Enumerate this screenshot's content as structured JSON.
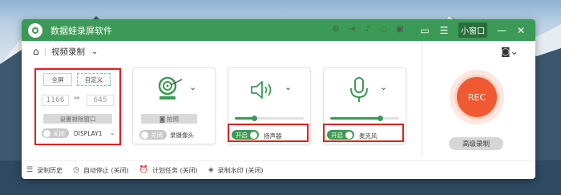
{
  "app": {
    "title": "数据蛙录屏软件"
  },
  "titlebar": {
    "mini_window_label": "小窗口",
    "icons": [
      "chat-icon",
      "menu-icon",
      "minimize-icon",
      "close-icon"
    ]
  },
  "toolbar": {
    "mode_label": "视频录制",
    "icons": [
      "gear-icon",
      "export-icon",
      "volume-icon",
      "mouse-icon",
      "fit-icon"
    ]
  },
  "screen_panel": {
    "fullscreen_label": "全屏",
    "custom_label": "自定义",
    "width_value": "1166",
    "height_value": "645",
    "exclude_window_label": "设置排除窗口",
    "toggle_state": "关闭",
    "display_label": "DISPLAY1"
  },
  "camera_panel": {
    "photo_label": "拍照",
    "toggle_state": "关闭",
    "label": "录摄像头"
  },
  "speaker_panel": {
    "toggle_state": "开启",
    "label": "扬声器",
    "volume_level": 0.28
  },
  "mic_panel": {
    "toggle_state": "开启",
    "label": "麦克风",
    "volume_level": 0.72
  },
  "record": {
    "rec_label": "REC",
    "advanced_label": "高级录制"
  },
  "statusbar": {
    "history": "录制历史",
    "auto_stop": "自动停止 (关闭)",
    "schedule": "计划任务 (关闭)",
    "watermark": "录制水印 (关闭)"
  },
  "colors": {
    "accent": "#3b9a55",
    "rec": "#f05a32",
    "highlight": "#e02020"
  }
}
